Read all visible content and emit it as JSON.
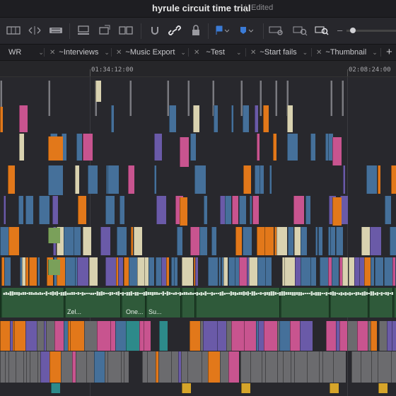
{
  "window": {
    "title": "hyrule circuit time trial",
    "status": "Edited"
  },
  "toolbar": {
    "tools": [
      "edit-mode-icon",
      "trim-mode-icon",
      "blade-icon",
      "insert-icon",
      "overwrite-icon",
      "replace-icon",
      "snapping-icon",
      "linked-selection-icon",
      "lock-icon",
      "flag-icon",
      "marker-icon",
      "zoom-fit-icon",
      "zoom-detail-icon",
      "zoom-custom-icon"
    ],
    "zoom_minus": "–"
  },
  "tabs": [
    {
      "label": "WR",
      "closable": false
    },
    {
      "label": "~Interviews",
      "closable": true
    },
    {
      "label": "~Music Export",
      "closable": true
    },
    {
      "label": "~Test",
      "closable": true
    },
    {
      "label": "~Start fails",
      "closable": true
    },
    {
      "label": "~Thumbnail",
      "closable": true
    }
  ],
  "tab_add": "+",
  "ruler": {
    "timecodes": [
      "01:34:12:00",
      "02:08:24:00"
    ]
  },
  "audio_clips": [
    {
      "label": "Zel..."
    },
    {
      "label": "One..."
    },
    {
      "label": "Su..."
    }
  ],
  "colors": {
    "blue": "#45709a",
    "orange": "#e2781a",
    "pink": "#c8548f",
    "cream": "#d9d2b0",
    "purple": "#6a5aa8",
    "teal": "#2d8a8a",
    "gray": "#6b6b6e",
    "audio": "#3e7a4d",
    "yellow": "#d6a52a"
  }
}
